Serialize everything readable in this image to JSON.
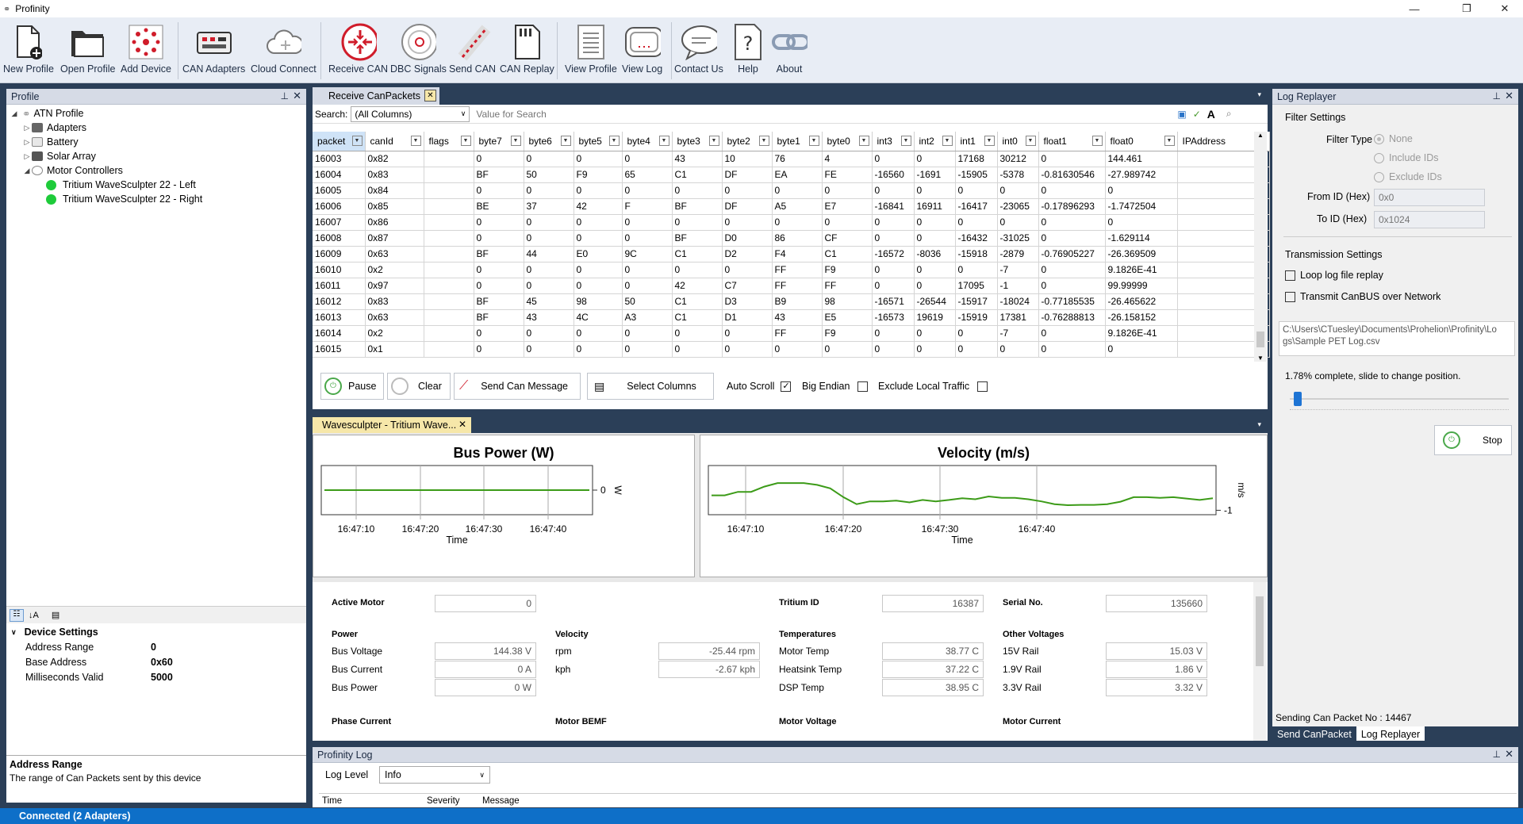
{
  "app": {
    "title": "Profinity",
    "window_controls": [
      "—",
      "❐",
      "✕"
    ]
  },
  "toolbar": {
    "items": [
      {
        "label": "New Profile",
        "icon": "new-profile-icon"
      },
      {
        "label": "Open Profile",
        "icon": "open-folder-icon"
      },
      {
        "label": "Add Device",
        "icon": "add-device-icon"
      },
      {
        "label": "CAN Adapters",
        "icon": "can-adapter-icon"
      },
      {
        "label": "Cloud Connect",
        "icon": "cloud-icon"
      },
      {
        "label": "Receive CAN",
        "icon": "receive-can-icon"
      },
      {
        "label": "DBC Signals",
        "icon": "dbc-signals-icon"
      },
      {
        "label": "Send CAN",
        "icon": "send-can-icon"
      },
      {
        "label": "CAN Replay",
        "icon": "sd-card-icon"
      },
      {
        "label": "View Profile",
        "icon": "view-profile-icon"
      },
      {
        "label": "View Log",
        "icon": "view-log-icon"
      },
      {
        "label": "Contact Us",
        "icon": "chat-bubble-icon"
      },
      {
        "label": "Help",
        "icon": "help-icon"
      },
      {
        "label": "About",
        "icon": "link-icon"
      }
    ]
  },
  "profile_panel": {
    "title": "Profile",
    "tree": [
      {
        "label": "ATN Profile",
        "level": 0
      },
      {
        "label": "Adapters",
        "level": 1
      },
      {
        "label": "Battery",
        "level": 1
      },
      {
        "label": "Solar Array",
        "level": 1
      },
      {
        "label": "Motor Controllers",
        "level": 1
      },
      {
        "label": "Tritium WaveSculpter 22 - Left",
        "level": 2
      },
      {
        "label": "Tritium WaveSculpter 22 - Right",
        "level": 2
      }
    ],
    "settings_header": "Device Settings",
    "settings": [
      {
        "name": "Address Range",
        "value": "0"
      },
      {
        "name": "Base Address",
        "value": "0x60"
      },
      {
        "name": "Milliseconds Valid",
        "value": "5000"
      }
    ],
    "desc_title": "Address Range",
    "desc_text": "The range of Can Packets sent by this device"
  },
  "receive": {
    "tab": "Receive CanPackets",
    "search_label": "Search:",
    "search_scope": "(All Columns)",
    "search_placeholder": "Value for Search",
    "columns": [
      "packet",
      "canId",
      "flags",
      "byte7",
      "byte6",
      "byte5",
      "byte4",
      "byte3",
      "byte2",
      "byte1",
      "byte0",
      "int3",
      "int2",
      "int1",
      "int0",
      "float1",
      "float0",
      "IPAddress"
    ],
    "rows": [
      [
        "16003",
        "0x82",
        "",
        "0",
        "0",
        "0",
        "0",
        "43",
        "10",
        "76",
        "4",
        "0",
        "0",
        "17168",
        "30212",
        "0",
        "144.461",
        ""
      ],
      [
        "16004",
        "0x83",
        "",
        "BF",
        "50",
        "F9",
        "65",
        "C1",
        "DF",
        "EA",
        "FE",
        "-16560",
        "-1691",
        "-15905",
        "-5378",
        "-0.81630546",
        "-27.989742",
        ""
      ],
      [
        "16005",
        "0x84",
        "",
        "0",
        "0",
        "0",
        "0",
        "0",
        "0",
        "0",
        "0",
        "0",
        "0",
        "0",
        "0",
        "0",
        "0",
        ""
      ],
      [
        "16006",
        "0x85",
        "",
        "BE",
        "37",
        "42",
        "F",
        "BF",
        "DF",
        "A5",
        "E7",
        "-16841",
        "16911",
        "-16417",
        "-23065",
        "-0.17896293",
        "-1.7472504",
        ""
      ],
      [
        "16007",
        "0x86",
        "",
        "0",
        "0",
        "0",
        "0",
        "0",
        "0",
        "0",
        "0",
        "0",
        "0",
        "0",
        "0",
        "0",
        "0",
        ""
      ],
      [
        "16008",
        "0x87",
        "",
        "0",
        "0",
        "0",
        "0",
        "BF",
        "D0",
        "86",
        "CF",
        "0",
        "0",
        "-16432",
        "-31025",
        "0",
        "-1.629114",
        ""
      ],
      [
        "16009",
        "0x63",
        "",
        "BF",
        "44",
        "E0",
        "9C",
        "C1",
        "D2",
        "F4",
        "C1",
        "-16572",
        "-8036",
        "-15918",
        "-2879",
        "-0.76905227",
        "-26.369509",
        ""
      ],
      [
        "16010",
        "0x2",
        "",
        "0",
        "0",
        "0",
        "0",
        "0",
        "0",
        "FF",
        "F9",
        "0",
        "0",
        "0",
        "-7",
        "0",
        "9.1826E-41",
        ""
      ],
      [
        "16011",
        "0x97",
        "",
        "0",
        "0",
        "0",
        "0",
        "42",
        "C7",
        "FF",
        "FF",
        "0",
        "0",
        "17095",
        "-1",
        "0",
        "99.99999",
        ""
      ],
      [
        "16012",
        "0x83",
        "",
        "BF",
        "45",
        "98",
        "50",
        "C1",
        "D3",
        "B9",
        "98",
        "-16571",
        "-26544",
        "-15917",
        "-18024",
        "-0.77185535",
        "-26.465622",
        ""
      ],
      [
        "16013",
        "0x63",
        "",
        "BF",
        "43",
        "4C",
        "A3",
        "C1",
        "D1",
        "43",
        "E5",
        "-16573",
        "19619",
        "-15919",
        "17381",
        "-0.76288813",
        "-26.158152",
        ""
      ],
      [
        "16014",
        "0x2",
        "",
        "0",
        "0",
        "0",
        "0",
        "0",
        "0",
        "FF",
        "F9",
        "0",
        "0",
        "0",
        "-7",
        "0",
        "9.1826E-41",
        ""
      ],
      [
        "16015",
        "0x1",
        "",
        "0",
        "0",
        "0",
        "0",
        "0",
        "0",
        "0",
        "0",
        "0",
        "0",
        "0",
        "0",
        "0",
        "0",
        ""
      ]
    ],
    "buttons": {
      "pause": "Pause",
      "clear": "Clear",
      "send": "Send Can Message",
      "select": "Select Columns"
    },
    "options": {
      "auto_scroll": "Auto Scroll",
      "big_endian": "Big Endian",
      "exclude_local": "Exclude Local Traffic"
    }
  },
  "wave": {
    "tab": "Wavesculpter - Tritium Wave...",
    "bus_power": {
      "title": "Bus Power (W)",
      "xlabel": "Time",
      "ylabel": "W",
      "yticks": [
        "0"
      ],
      "xticks": [
        "16:47:10",
        "16:47:20",
        "16:47:30",
        "16:47:40"
      ]
    },
    "velocity": {
      "title": "Velocity (m/s)",
      "xlabel": "Time",
      "ylabel": "m/s",
      "yticks": [
        "-1"
      ],
      "xticks": [
        "16:47:10",
        "16:47:20",
        "16:47:30",
        "16:47:40"
      ]
    },
    "active_motor": {
      "label": "Active Motor",
      "value": "0"
    },
    "tritium_id": {
      "label": "Tritium ID",
      "value": "16387"
    },
    "serial": {
      "label": "Serial No.",
      "value": "135660"
    },
    "power": {
      "header": "Power",
      "rows": [
        {
          "label": "Bus Voltage",
          "value": "144.38 V"
        },
        {
          "label": "Bus Current",
          "value": "0 A"
        },
        {
          "label": "Bus Power",
          "value": "0 W"
        }
      ]
    },
    "velocity_grp": {
      "header": "Velocity",
      "rows": [
        {
          "label": "rpm",
          "value": "-25.44 rpm"
        },
        {
          "label": "kph",
          "value": "-2.67 kph"
        }
      ]
    },
    "temps": {
      "header": "Temperatures",
      "rows": [
        {
          "label": "Motor Temp",
          "value": "38.77 C"
        },
        {
          "label": "Heatsink Temp",
          "value": "37.22 C"
        },
        {
          "label": "DSP Temp",
          "value": "38.95 C"
        }
      ]
    },
    "voltages": {
      "header": "Other Voltages",
      "rows": [
        {
          "label": "15V Rail",
          "value": "15.03 V"
        },
        {
          "label": "1.9V Rail",
          "value": "1.86 V"
        },
        {
          "label": "3.3V Rail",
          "value": "3.32 V"
        }
      ]
    },
    "bottom_headers": [
      "Phase Current",
      "Motor BEMF",
      "Motor Voltage",
      "Motor Current"
    ]
  },
  "chart_data": [
    {
      "type": "line",
      "title": "Bus Power (W)",
      "xlabel": "Time",
      "ylabel": "W",
      "x_ticks": [
        "16:47:10",
        "16:47:20",
        "16:47:30",
        "16:47:40"
      ],
      "ylim": [
        -1,
        1
      ],
      "series": [
        {
          "values": [
            0,
            0,
            0,
            0,
            0,
            0,
            0,
            0,
            0,
            0,
            0,
            0,
            0,
            0,
            0,
            0,
            0,
            0,
            0,
            0
          ]
        }
      ]
    },
    {
      "type": "line",
      "title": "Velocity (m/s)",
      "xlabel": "Time",
      "ylabel": "m/s",
      "x_ticks": [
        "16:47:10",
        "16:47:20",
        "16:47:30",
        "16:47:40"
      ],
      "ylim": [
        -1.1,
        0.3
      ],
      "series": [
        {
          "values": [
            -0.55,
            -0.55,
            -0.45,
            -0.45,
            -0.3,
            -0.2,
            -0.2,
            -0.2,
            -0.25,
            -0.35,
            -0.6,
            -0.8,
            -0.72,
            -0.72,
            -0.7,
            -0.75,
            -0.68,
            -0.72,
            -0.68,
            -0.63,
            -0.66,
            -0.58,
            -0.62,
            -0.62,
            -0.66,
            -0.72,
            -0.8,
            -0.83,
            -0.82,
            -0.82,
            -0.8,
            -0.73,
            -0.6,
            -0.6,
            -0.62,
            -0.6,
            -0.64,
            -0.68,
            -0.63
          ]
        }
      ]
    }
  ],
  "log": {
    "title": "Profinity Log",
    "level_label": "Log Level",
    "level_value": "Info",
    "columns": [
      "Time",
      "Severity",
      "Message"
    ]
  },
  "replayer": {
    "title": "Log Replayer",
    "filter_header": "Filter Settings",
    "filter_type": "Filter Type",
    "options": [
      "None",
      "Include IDs",
      "Exclude IDs"
    ],
    "from_label": "From ID (Hex)",
    "from_placeholder": "0x0",
    "to_label": "To ID (Hex)",
    "to_placeholder": "0x1024",
    "tx_header": "Transmission Settings",
    "loop": "Loop log file replay",
    "transmit": "Transmit CanBUS over Network",
    "path": "C:\\Users\\CTuesley\\Documents\\Prohelion\\Profinity\\Logs\\Sample PET Log.csv",
    "progress_text": "1.78% complete, slide to change position.",
    "progress": 0.0178,
    "stop": "Stop",
    "sending": "Sending Can Packet No : 14467",
    "tabs": [
      "Send CanPacket",
      "Log Replayer"
    ]
  },
  "status": {
    "text": "Connected (2 Adapters)"
  }
}
